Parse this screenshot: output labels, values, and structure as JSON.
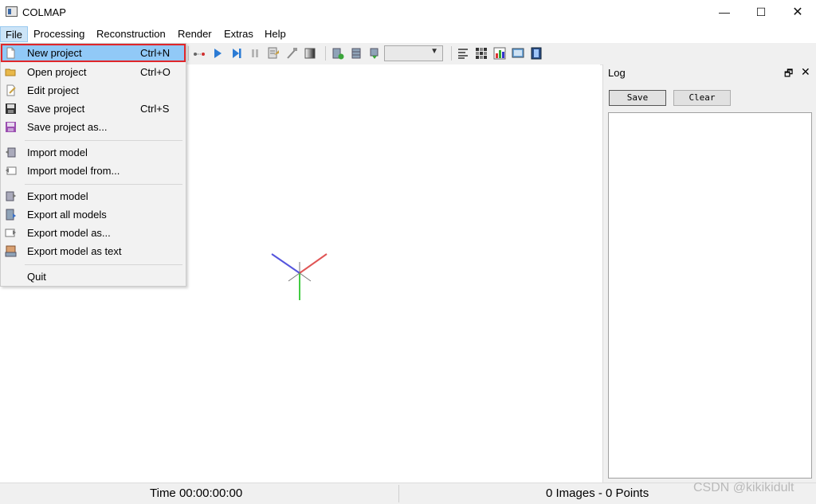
{
  "window": {
    "title": "COLMAP"
  },
  "window_controls": {
    "minimize": "—",
    "maximize": "☐",
    "close": "✕"
  },
  "menubar": [
    "File",
    "Processing",
    "Reconstruction",
    "Render",
    "Extras",
    "Help"
  ],
  "file_menu": {
    "items": [
      {
        "label": "New project",
        "shortcut": "Ctrl+N",
        "icon": "new-file-icon",
        "highlighted": true
      },
      {
        "label": "Open project",
        "shortcut": "Ctrl+O",
        "icon": "folder-open-icon"
      },
      {
        "label": "Edit project",
        "shortcut": "",
        "icon": "edit-project-icon"
      },
      {
        "label": "Save project",
        "shortcut": "Ctrl+S",
        "icon": "save-icon"
      },
      {
        "label": "Save project as...",
        "shortcut": "",
        "icon": "save-as-icon"
      },
      {
        "label": "Import model",
        "shortcut": "",
        "icon": "import-model-icon"
      },
      {
        "label": "Import model from...",
        "shortcut": "",
        "icon": "import-model-from-icon"
      },
      {
        "label": "Export model",
        "shortcut": "",
        "icon": "export-model-icon"
      },
      {
        "label": "Export all models",
        "shortcut": "",
        "icon": "export-all-models-icon"
      },
      {
        "label": "Export model as...",
        "shortcut": "",
        "icon": "export-model-as-icon"
      },
      {
        "label": "Export model as text",
        "shortcut": "",
        "icon": "export-text-icon"
      },
      {
        "label": "Quit",
        "shortcut": "",
        "icon": ""
      }
    ]
  },
  "toolbar": {
    "icons": [
      "feature-matching-icon",
      "play-icon",
      "step-forward-icon",
      "pause-icon",
      "reconstruction-options-icon",
      "bundle-adjustment-icon",
      "render-toggle-icon",
      "database-add-icon",
      "database-icon",
      "database-download-icon",
      "log-list-icon",
      "match-matrix-icon",
      "statistics-chart-icon",
      "image-viewer-icon",
      "film-grab-icon"
    ],
    "model_select_value": ""
  },
  "log": {
    "title": "Log",
    "save_label": "Save",
    "clear_label": "Clear",
    "content": ""
  },
  "status": {
    "time": "Time 00:00:00:00",
    "counts": "0 Images - 0 Points"
  },
  "watermark": "CSDN @kikikidult",
  "colors": {
    "menu_highlight": "#91c9f7",
    "highlight_border": "#e0262a",
    "axis_x": "#e05555",
    "axis_y": "#44cc44",
    "axis_z": "#5555dd"
  }
}
